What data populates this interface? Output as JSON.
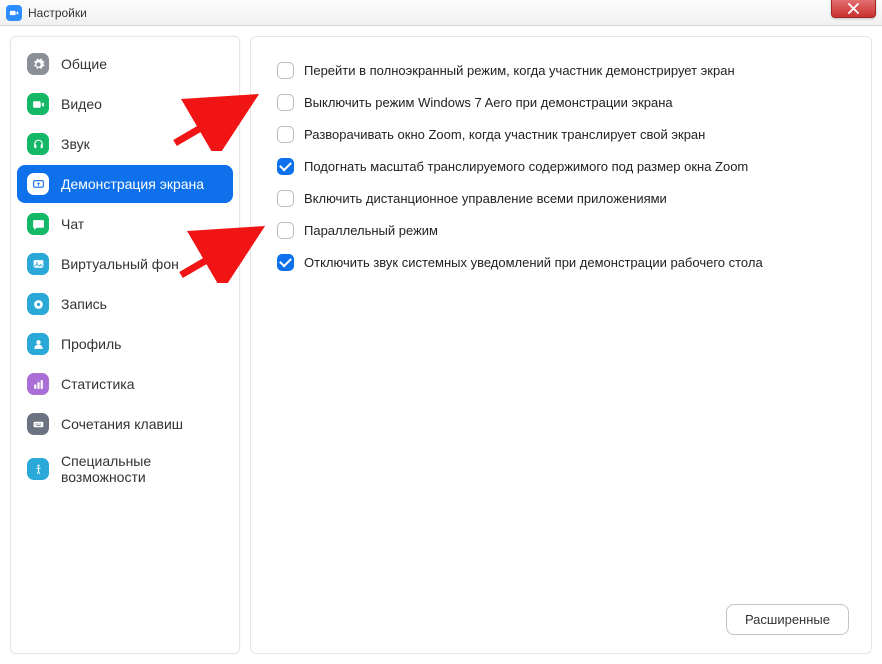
{
  "window": {
    "title": "Настройки"
  },
  "sidebar": {
    "items": [
      {
        "label": "Общие",
        "icon": "gear",
        "color": "#8a8f98"
      },
      {
        "label": "Видео",
        "icon": "video",
        "color": "#14b866"
      },
      {
        "label": "Звук",
        "icon": "headphones",
        "color": "#14b866"
      },
      {
        "label": "Демонстрация экрана",
        "icon": "share",
        "color": "#0E71EB",
        "active": true
      },
      {
        "label": "Чат",
        "icon": "chat",
        "color": "#14b866"
      },
      {
        "label": "Виртуальный фон",
        "icon": "image",
        "color": "#2aa8d8"
      },
      {
        "label": "Запись",
        "icon": "record",
        "color": "#2aa8d8"
      },
      {
        "label": "Профиль",
        "icon": "person",
        "color": "#2aa8d8"
      },
      {
        "label": "Статистика",
        "icon": "stats",
        "color": "#a96fd6"
      },
      {
        "label": "Сочетания клавиш",
        "icon": "keyboard",
        "color": "#6b7280"
      },
      {
        "label": "Специальные возможности",
        "icon": "access",
        "color": "#2aa8d8"
      }
    ]
  },
  "content": {
    "options": [
      {
        "label": "Перейти в полноэкранный режим, когда участник демонстрирует экран",
        "checked": false
      },
      {
        "label": "Выключить режим Windows 7 Aero при демонстрации экрана",
        "checked": false
      },
      {
        "label": "Разворачивать окно Zoom, когда участник транслирует свой экран",
        "checked": false
      },
      {
        "label": "Подогнать масштаб транслируемого содержимого под размер окна Zoom",
        "checked": true
      },
      {
        "label": "Включить дистанционное управление всеми приложениями",
        "checked": false
      },
      {
        "label": "Параллельный режим",
        "checked": false
      },
      {
        "label": "Отключить звук системных уведомлений при демонстрации рабочего стола",
        "checked": true
      }
    ],
    "advanced_label": "Расширенные"
  },
  "icons": {
    "gear": "gear-icon",
    "video": "video-icon",
    "headphones": "headphones-icon",
    "share": "share-screen-icon",
    "chat": "chat-icon",
    "image": "image-icon",
    "record": "record-icon",
    "person": "person-icon",
    "stats": "stats-icon",
    "keyboard": "keyboard-icon",
    "access": "accessibility-icon"
  },
  "colors": {
    "accent": "#0E71EB",
    "arrow": "#f01414"
  }
}
